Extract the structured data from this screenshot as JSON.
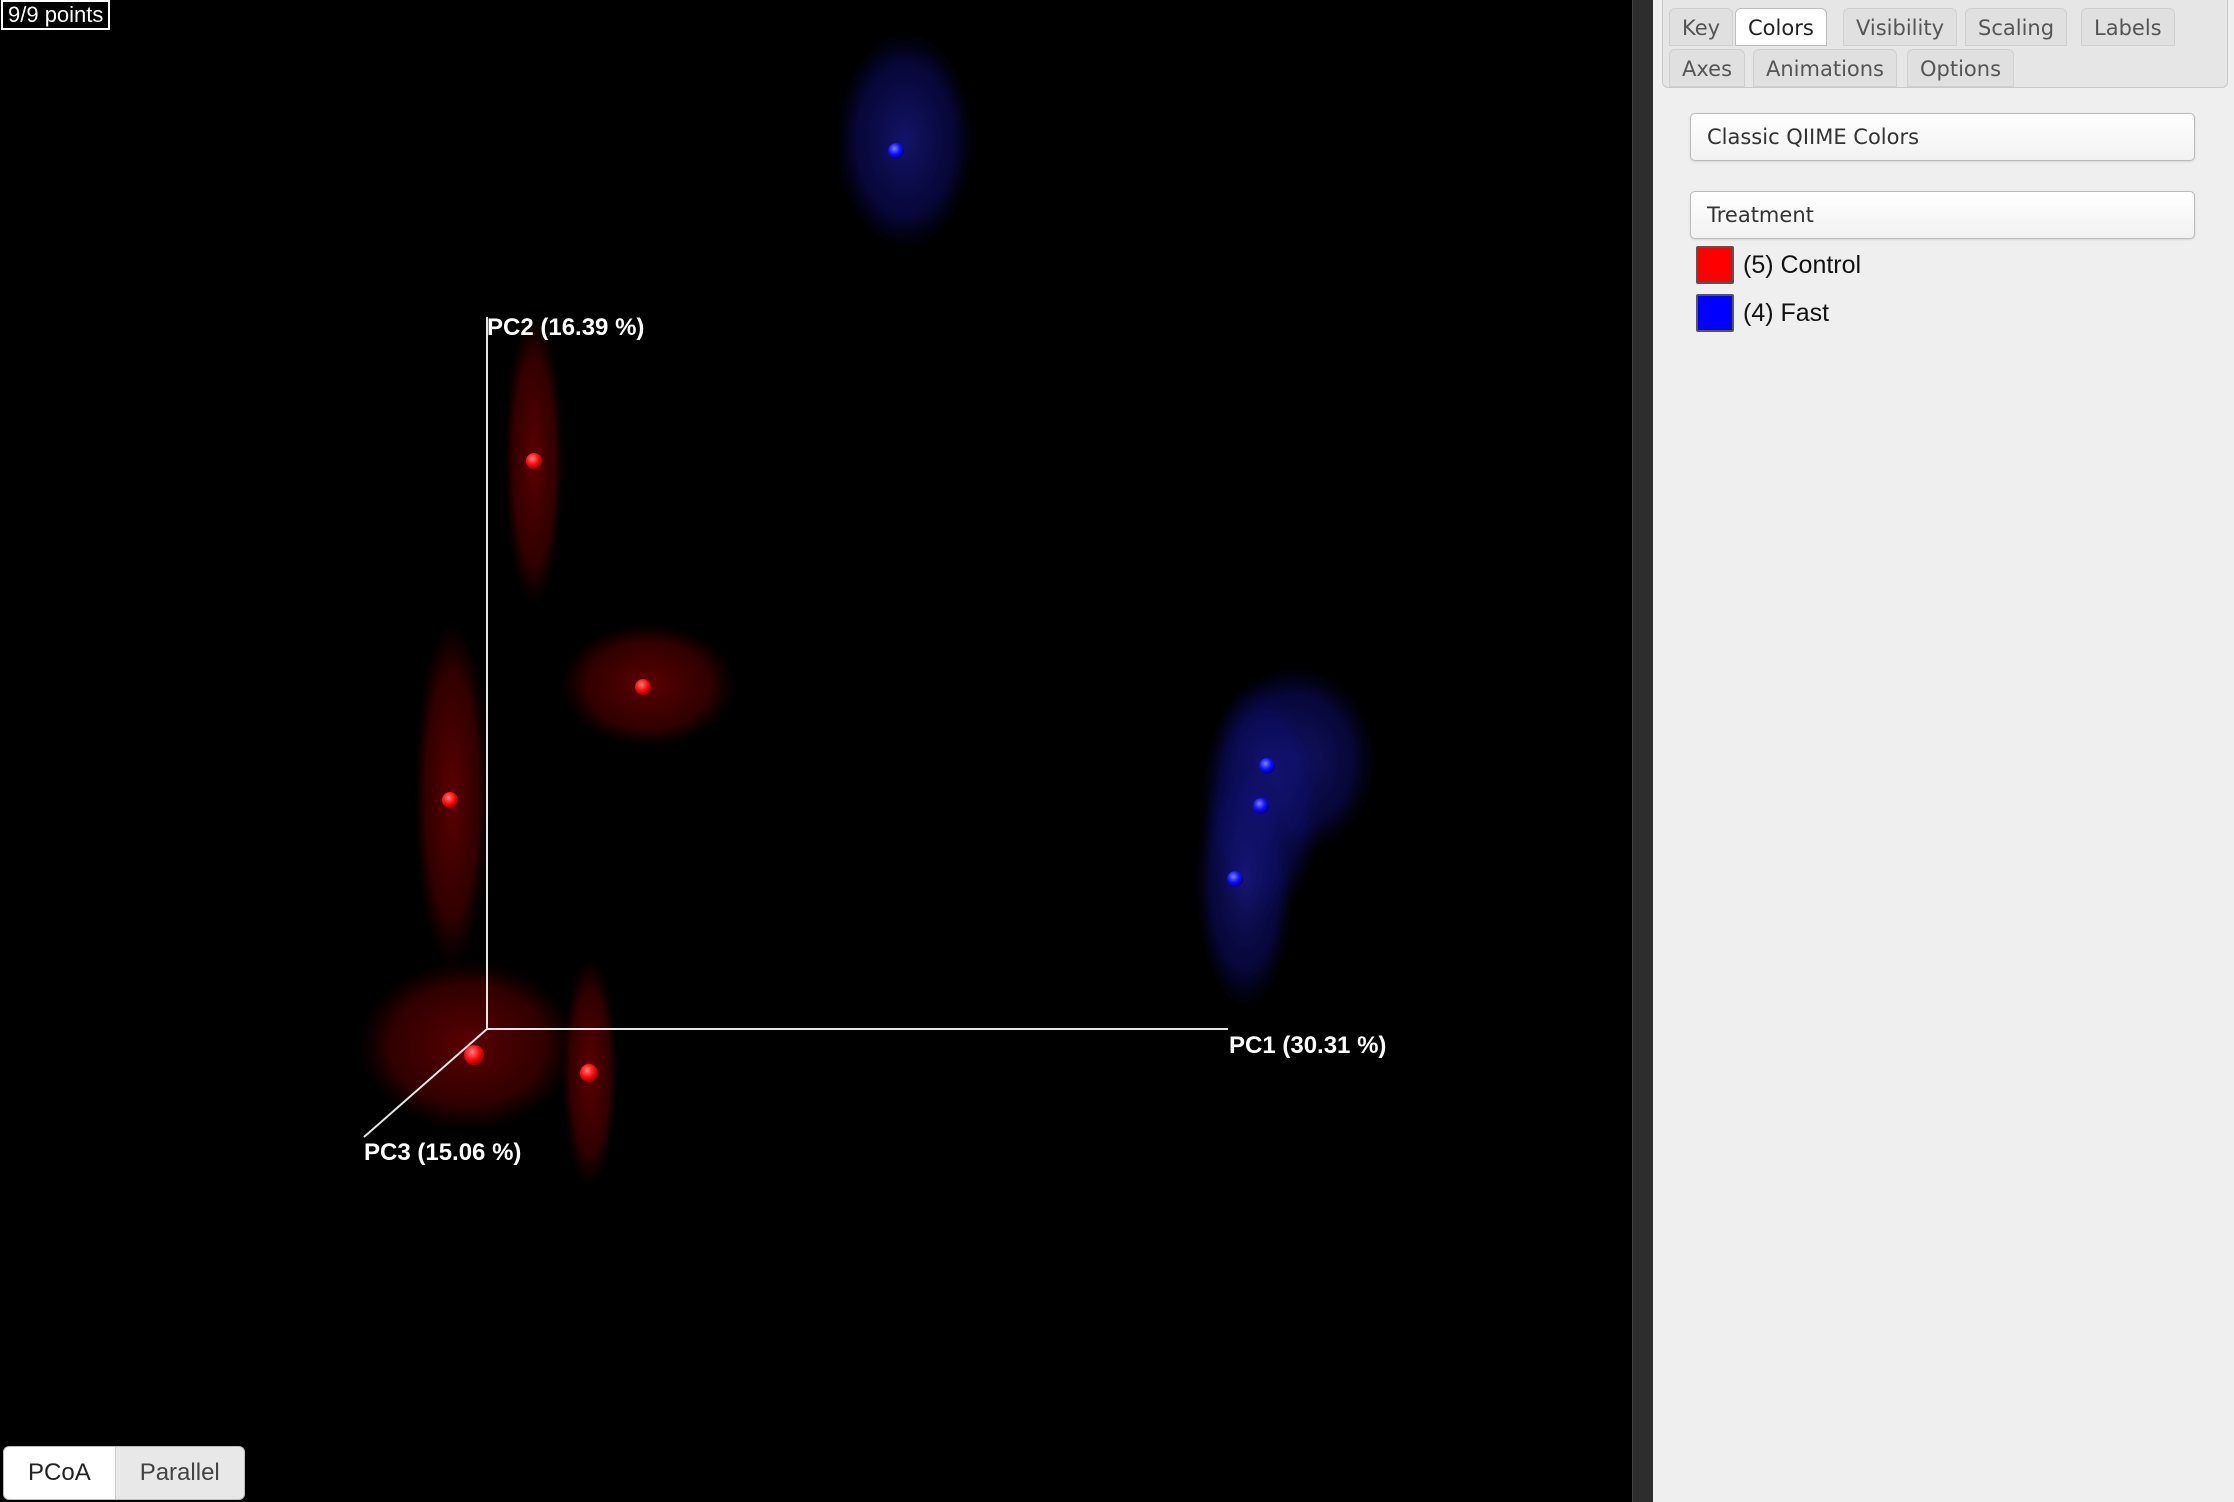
{
  "plot": {
    "points_counter": "9/9 points",
    "background": "#000000",
    "axes": {
      "pc1": "PC1 (30.31 %)",
      "pc2": "PC2 (16.39 %)",
      "pc3": "PC3 (15.06 %)"
    },
    "view_tabs": [
      {
        "label": "PCoA",
        "active": true
      },
      {
        "label": "Parallel",
        "active": false
      }
    ]
  },
  "panel": {
    "tabs": [
      {
        "label": "Key",
        "active": false
      },
      {
        "label": "Colors",
        "active": true
      },
      {
        "label": "Visibility",
        "active": false
      },
      {
        "label": "Scaling",
        "active": false
      },
      {
        "label": "Labels",
        "active": false
      },
      {
        "label": "Axes",
        "active": false
      },
      {
        "label": "Animations",
        "active": false
      },
      {
        "label": "Options",
        "active": false
      }
    ],
    "colormap_select": "Classic QIIME Colors",
    "category_select": "Treatment",
    "legend": [
      {
        "label": "(5) Control",
        "color": "#ff0000"
      },
      {
        "label": "(4) Fast",
        "color": "#0000ff"
      }
    ]
  }
}
